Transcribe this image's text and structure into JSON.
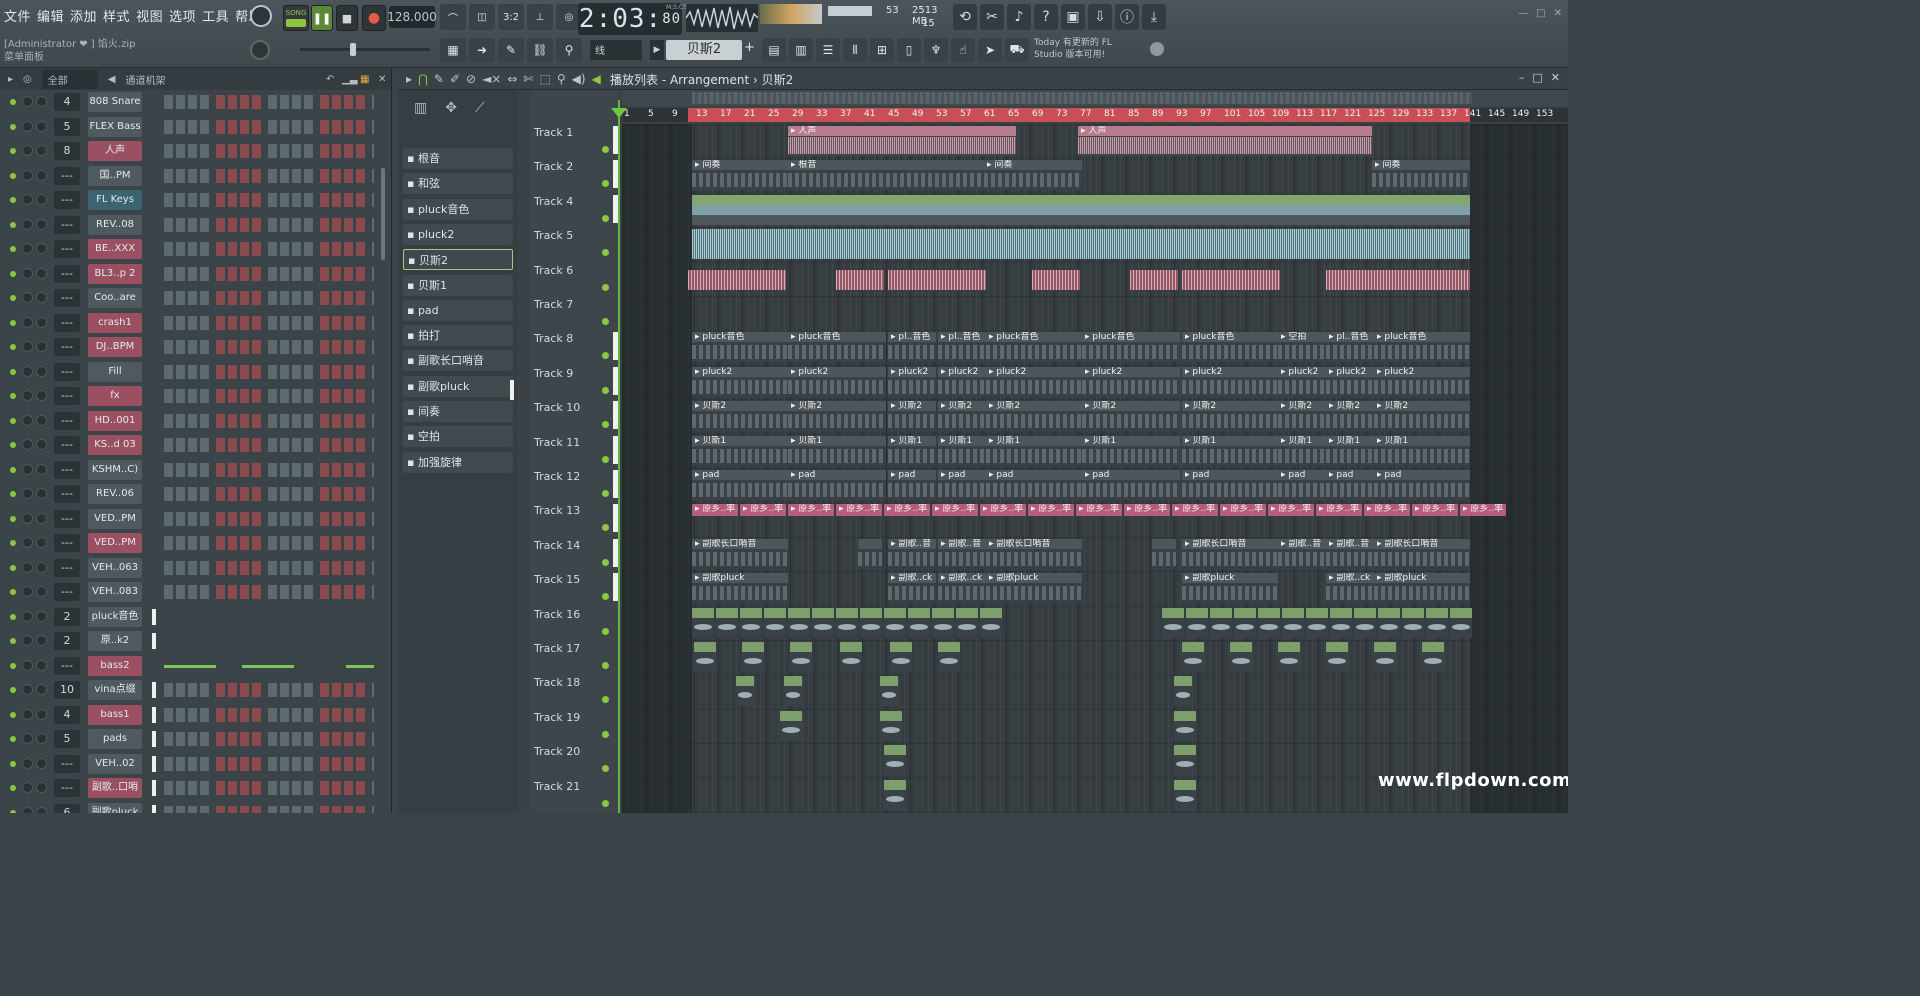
{
  "menu": [
    "文件",
    "编辑",
    "添加",
    "样式",
    "视图",
    "选项",
    "工具",
    "帮助"
  ],
  "hint": {
    "line1": "[Administrator ❤   ] 馅火.zip",
    "line2": "菜单面板"
  },
  "transport": {
    "song_label": "SONG",
    "play_label": "❚❚",
    "stop_label": "■",
    "rec_label": "●",
    "tempo": "128.000"
  },
  "time": {
    "main": "2:03",
    "sub": "80",
    "unit": "M:S:CS"
  },
  "cpu": {
    "value1": "53",
    "value2": "2513 MB",
    "value3": "15"
  },
  "snap": "线",
  "pattern_name": "贝斯2",
  "news": {
    "line1": "Today  有更新的 FL",
    "line2": "Studio 版本可用!"
  },
  "rack": {
    "filter": "全部",
    "title": "通道机架",
    "channels": [
      {
        "num": "4",
        "name": "808 Snare",
        "style": "plain"
      },
      {
        "num": "5",
        "name": "FLEX Bass",
        "style": "plain"
      },
      {
        "num": "8",
        "name": "人声",
        "style": "pink"
      },
      {
        "num": "---",
        "name": "国..PM",
        "style": "plain"
      },
      {
        "num": "---",
        "name": "FL Keys",
        "style": "teal"
      },
      {
        "num": "---",
        "name": "REV..08",
        "style": "plain"
      },
      {
        "num": "---",
        "name": "BE..XXX",
        "style": "pink"
      },
      {
        "num": "---",
        "name": "BL3..p 2",
        "style": "pink"
      },
      {
        "num": "---",
        "name": "Coo..are",
        "style": "plain"
      },
      {
        "num": "---",
        "name": "crash1",
        "style": "pink"
      },
      {
        "num": "---",
        "name": "DJ..BPM",
        "style": "pink"
      },
      {
        "num": "---",
        "name": "Fill",
        "style": "plain"
      },
      {
        "num": "---",
        "name": "fx",
        "style": "pink"
      },
      {
        "num": "---",
        "name": "HD..001",
        "style": "pink"
      },
      {
        "num": "---",
        "name": "KS..d 03",
        "style": "pink"
      },
      {
        "num": "---",
        "name": "KSHM..C)",
        "style": "plain"
      },
      {
        "num": "---",
        "name": "REV..06",
        "style": "plain"
      },
      {
        "num": "---",
        "name": "VED..PM",
        "style": "plain"
      },
      {
        "num": "---",
        "name": "VED..PM",
        "style": "pink"
      },
      {
        "num": "---",
        "name": "VEH..063",
        "style": "plain"
      },
      {
        "num": "---",
        "name": "VEH..083",
        "style": "plain"
      },
      {
        "num": "2",
        "name": "pluck音色",
        "style": "plain"
      },
      {
        "num": "2",
        "name": "原..k2",
        "style": "plain"
      },
      {
        "num": "---",
        "name": "bass2",
        "style": "pink"
      },
      {
        "num": "10",
        "name": "vina点缀",
        "style": "plain"
      },
      {
        "num": "4",
        "name": "bass1",
        "style": "pink"
      },
      {
        "num": "5",
        "name": "pads",
        "style": "plain"
      },
      {
        "num": "---",
        "name": "VEH..02",
        "style": "plain"
      },
      {
        "num": "---",
        "name": "副歌..口哨",
        "style": "pink"
      },
      {
        "num": "6",
        "name": "副歌pluck",
        "style": "plain"
      }
    ]
  },
  "playlist": {
    "title": "播放列表 - Arrangement",
    "crumb": "贝斯2",
    "patterns": [
      "根音",
      "和弦",
      "pluck音色",
      "pluck2",
      "贝斯2",
      "贝斯1",
      "pad",
      "拍打",
      "副歌长口哨音",
      "副歌pluck",
      "间奏",
      "空拍",
      "加强旋律"
    ],
    "selected_pattern": 4,
    "tracks": [
      "Track 1",
      "Track 2",
      "Track 4",
      "Track 5",
      "Track 6",
      "Track 7",
      "Track 8",
      "Track 9",
      "Track 10",
      "Track 11",
      "Track 12",
      "Track 13",
      "Track 14",
      "Track 15",
      "Track 16",
      "Track 17",
      "Track 18",
      "Track 19",
      "Track 20",
      "Track 21"
    ],
    "bars": [
      "1",
      "5",
      "9",
      "13",
      "17",
      "21",
      "25",
      "29",
      "33",
      "37",
      "41",
      "45",
      "49",
      "53",
      "57",
      "61",
      "65",
      "69",
      "73",
      "77",
      "81",
      "85",
      "89",
      "93",
      "97",
      "101",
      "105",
      "109",
      "113",
      "117",
      "121",
      "125",
      "129",
      "133",
      "137",
      "141",
      "145",
      "149",
      "153"
    ],
    "clips": {
      "vocal": "人声",
      "interlude": "间奏",
      "root": "根音",
      "pluck_tone": "pluck音色",
      "pluck2": "pluck2",
      "bass2": "贝斯2",
      "bass1": "贝斯1",
      "pad": "pad",
      "orig": "原乡..率",
      "whistle": "副歌长口哨音",
      "whistle_short": "副歌..音",
      "chorus_pluck": "副歌pluck",
      "chorus_pluck_short": "副歌..ck",
      "empty_beat": "空拍",
      "pluck_tone_short": "pl..音色"
    }
  },
  "watermark": "www.flpdown.com"
}
